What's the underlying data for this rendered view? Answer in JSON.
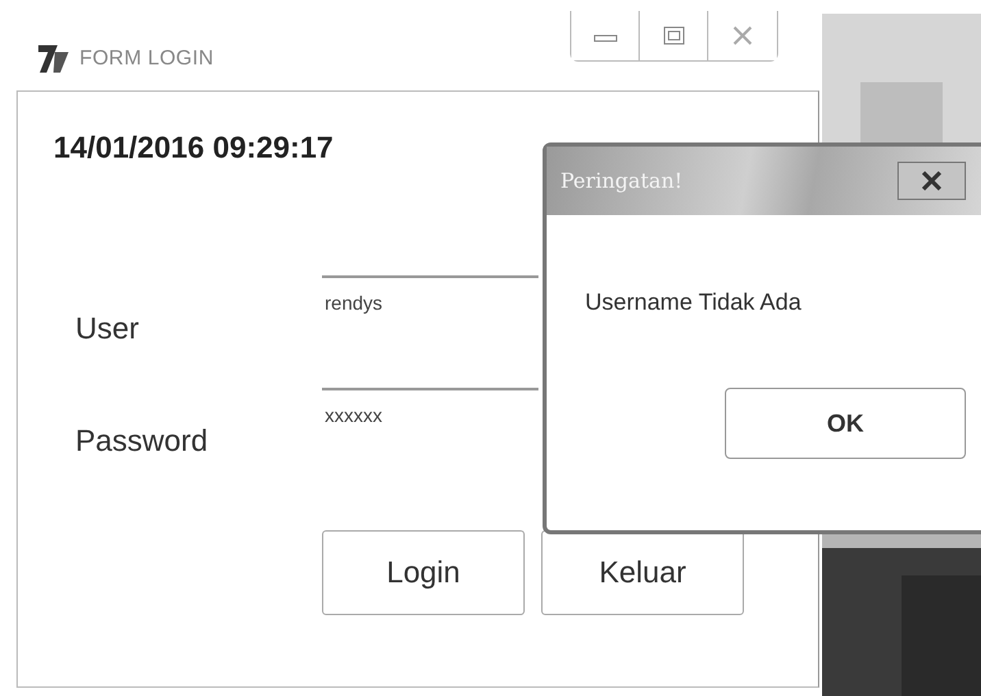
{
  "window": {
    "title": "FORM LOGIN",
    "datetime": "14/01/2016  09:29:17"
  },
  "fields": [
    {
      "label": "User",
      "value": "rendys"
    },
    {
      "label": "Password",
      "value": "xxxxxx"
    }
  ],
  "buttons": [
    "Login",
    "Keluar"
  ],
  "dialog": {
    "title": "Peringatan!",
    "message": "Username Tidak Ada",
    "button": "OK"
  }
}
